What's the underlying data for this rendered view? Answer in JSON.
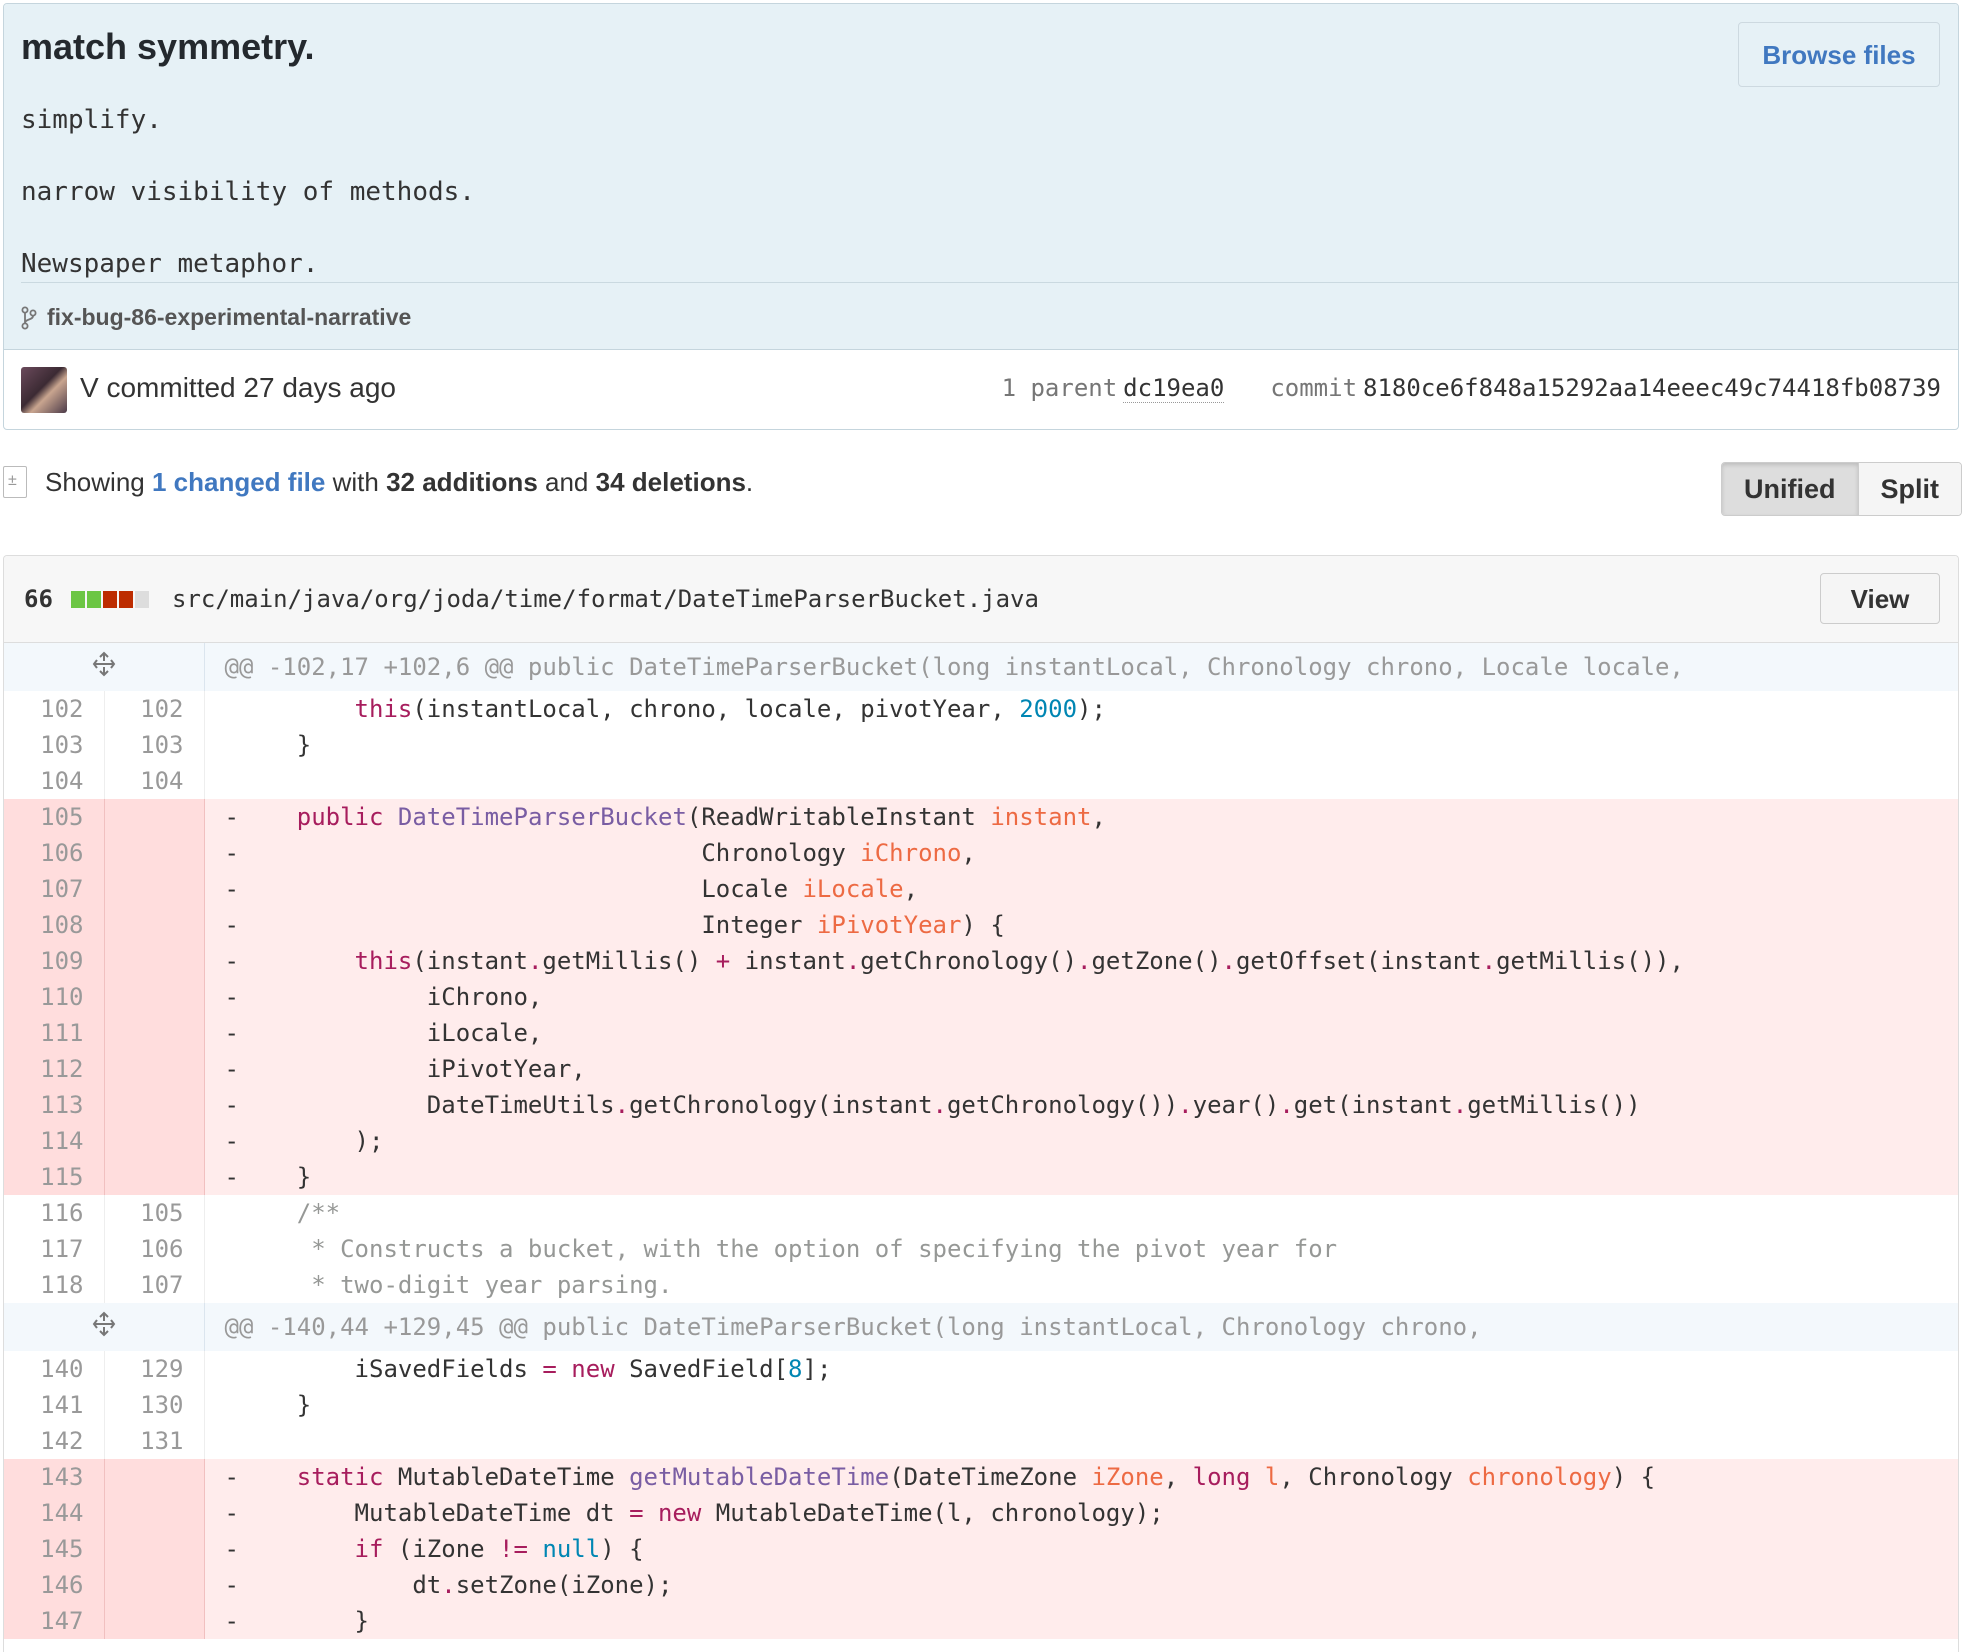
{
  "commit": {
    "title": "match symmetry.",
    "description_lines": [
      "simplify.",
      "narrow visibility of methods.",
      "Newspaper metaphor."
    ],
    "browse_files_label": "Browse files",
    "branch": "fix-bug-86-experimental-narrative",
    "author": "V",
    "committed_text": "committed 27 days ago",
    "parent_label": "1 parent",
    "parent_sha": "dc19ea0",
    "commit_label": "commit",
    "commit_sha": "8180ce6f848a15292aa14eeec49c74418fb08739"
  },
  "summary": {
    "showing": "Showing",
    "changed_files": "1 changed file",
    "with": "with",
    "additions": "32 additions",
    "and": "and",
    "deletions": "34 deletions",
    "period": ".",
    "unified_label": "Unified",
    "split_label": "Split"
  },
  "file": {
    "change_count": "66",
    "diffstat_colors": [
      "#6cc644",
      "#6cc644",
      "#bd2c00",
      "#bd2c00",
      "#dddddd"
    ],
    "path": "src/main/java/org/joda/time/format/DateTimeParserBucket.java",
    "view_label": "View",
    "icons": {
      "expand": "unfold-icon",
      "branch": "git-branch-icon",
      "file": "file-diff-icon"
    }
  },
  "colors": {
    "keyword": "#a71d5d",
    "function": "#795da3",
    "param": "#ed6a43",
    "number": "#0086b3",
    "comment": "#969896",
    "deleted_bg": "#ffecec",
    "hunk_bg": "#f3f8fc",
    "link": "#4078c0"
  },
  "diff_lines": [
    {
      "type": "hunk",
      "text": "@@ -102,17 +102,6 @@ public DateTimeParserBucket(long instantLocal, Chronology chrono, Locale locale,"
    },
    {
      "type": "ctx",
      "old": "102",
      "new": "102",
      "text": "        this(instantLocal, chrono, locale, pivotYear, 2000);"
    },
    {
      "type": "ctx",
      "old": "103",
      "new": "103",
      "text": "    }"
    },
    {
      "type": "ctx",
      "old": "104",
      "new": "104",
      "text": ""
    },
    {
      "type": "del",
      "old": "105",
      "new": "",
      "text": "-    public DateTimeParserBucket(ReadWritableInstant instant,"
    },
    {
      "type": "del",
      "old": "106",
      "new": "",
      "text": "-                                Chronology iChrono,"
    },
    {
      "type": "del",
      "old": "107",
      "new": "",
      "text": "-                                Locale iLocale,"
    },
    {
      "type": "del",
      "old": "108",
      "new": "",
      "text": "-                                Integer iPivotYear) {"
    },
    {
      "type": "del",
      "old": "109",
      "new": "",
      "text": "-        this(instant.getMillis() + instant.getChronology().getZone().getOffset(instant.getMillis()),"
    },
    {
      "type": "del",
      "old": "110",
      "new": "",
      "text": "-             iChrono,"
    },
    {
      "type": "del",
      "old": "111",
      "new": "",
      "text": "-             iLocale,"
    },
    {
      "type": "del",
      "old": "112",
      "new": "",
      "text": "-             iPivotYear,"
    },
    {
      "type": "del",
      "old": "113",
      "new": "",
      "text": "-             DateTimeUtils.getChronology(instant.getChronology()).year().get(instant.getMillis())"
    },
    {
      "type": "del",
      "old": "114",
      "new": "",
      "text": "-        );"
    },
    {
      "type": "del",
      "old": "115",
      "new": "",
      "text": "-    }"
    },
    {
      "type": "ctx",
      "old": "116",
      "new": "105",
      "text": "    /**"
    },
    {
      "type": "ctx",
      "old": "117",
      "new": "106",
      "text": "     * Constructs a bucket, with the option of specifying the pivot year for"
    },
    {
      "type": "ctx",
      "old": "118",
      "new": "107",
      "text": "     * two-digit year parsing."
    },
    {
      "type": "hunk",
      "text": "@@ -140,44 +129,45 @@ public DateTimeParserBucket(long instantLocal, Chronology chrono,"
    },
    {
      "type": "ctx",
      "old": "140",
      "new": "129",
      "text": "        iSavedFields = new SavedField[8];"
    },
    {
      "type": "ctx",
      "old": "141",
      "new": "130",
      "text": "    }"
    },
    {
      "type": "ctx",
      "old": "142",
      "new": "131",
      "text": ""
    },
    {
      "type": "del",
      "old": "143",
      "new": "",
      "text": "-    static MutableDateTime getMutableDateTime(DateTimeZone iZone, long l, Chronology chronology) {"
    },
    {
      "type": "del",
      "old": "144",
      "new": "",
      "text": "-        MutableDateTime dt = new MutableDateTime(l, chronology);"
    },
    {
      "type": "del",
      "old": "145",
      "new": "",
      "text": "-        if (iZone != null) {"
    },
    {
      "type": "del",
      "old": "146",
      "new": "",
      "text": "-            dt.setZone(iZone);"
    },
    {
      "type": "del",
      "old": "147",
      "new": "",
      "text": "-        }"
    }
  ]
}
